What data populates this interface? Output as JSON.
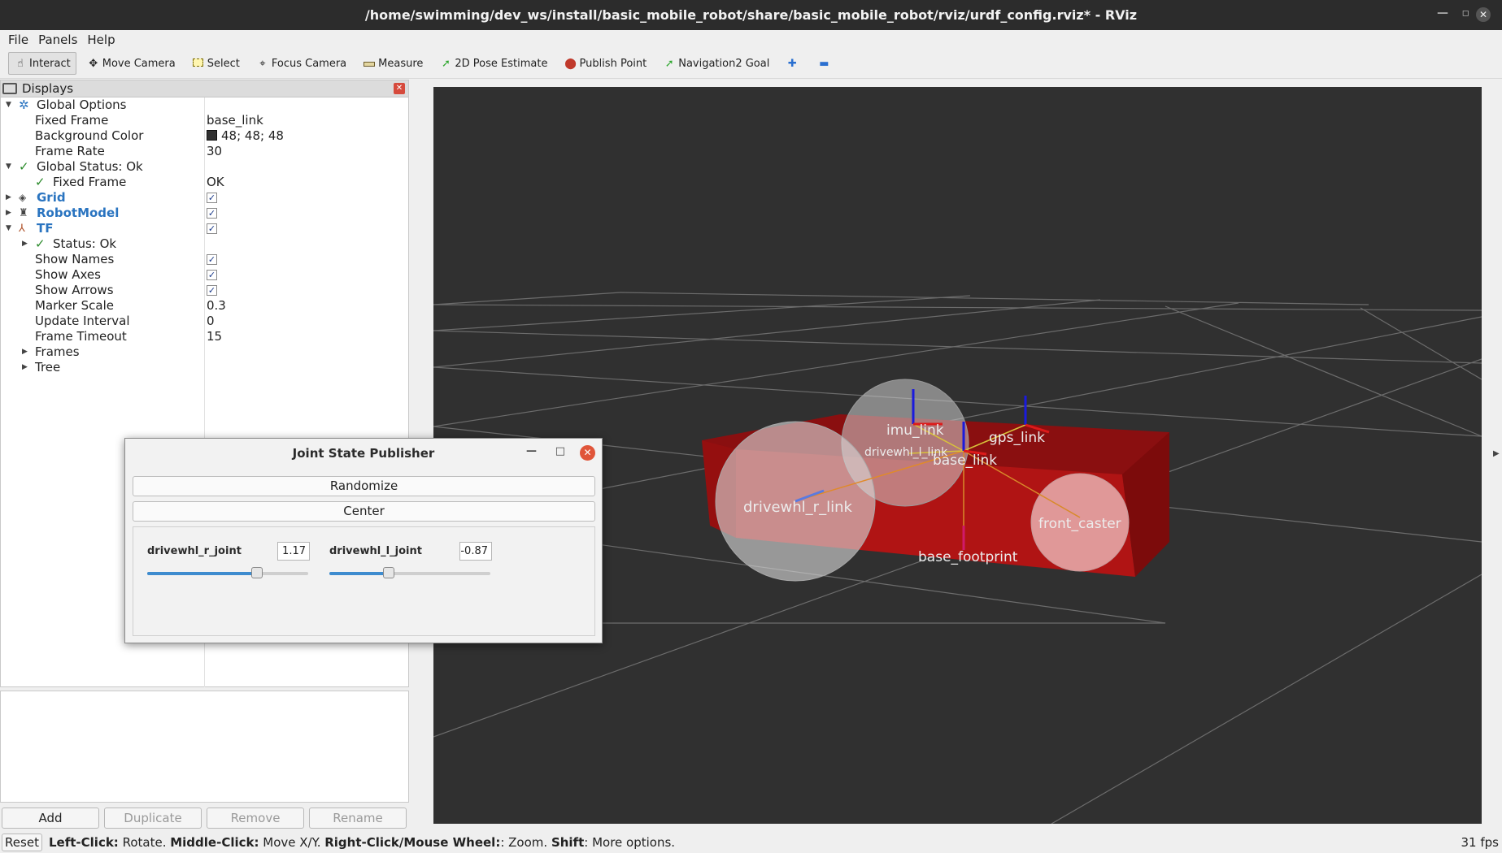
{
  "window": {
    "title": "/home/swimming/dev_ws/install/basic_mobile_robot/share/basic_mobile_robot/rviz/urdf_config.rviz* - RViz"
  },
  "menu": [
    "File",
    "Panels",
    "Help"
  ],
  "toolbar": [
    {
      "label": "Interact",
      "icon": "hand-icon",
      "active": true
    },
    {
      "label": "Move Camera",
      "icon": "move-camera-icon"
    },
    {
      "label": "Select",
      "icon": "select-icon"
    },
    {
      "label": "Focus Camera",
      "icon": "focus-camera-icon"
    },
    {
      "label": "Measure",
      "icon": "measure-icon"
    },
    {
      "label": "2D Pose Estimate",
      "icon": "pose-estimate-icon"
    },
    {
      "label": "Publish Point",
      "icon": "map-pin-icon"
    },
    {
      "label": "Navigation2 Goal",
      "icon": "nav-goal-icon"
    }
  ],
  "displays": {
    "title": "Displays",
    "global_options": {
      "label": "Global Options",
      "fixed_frame_label": "Fixed Frame",
      "fixed_frame": "base_link",
      "bg_label": "Background Color",
      "bg": "48; 48; 48",
      "bg_color": "#303030",
      "rate_label": "Frame Rate",
      "rate": "30"
    },
    "global_status": {
      "label": "Global Status: Ok",
      "fixed_frame_label": "Fixed Frame",
      "fixed_frame_value": "OK"
    },
    "grid": {
      "label": "Grid"
    },
    "robot_model": {
      "label": "RobotModel"
    },
    "tf": {
      "label": "TF",
      "status": "Status: Ok",
      "show_names_label": "Show Names",
      "show_axes_label": "Show Axes",
      "show_arrows_label": "Show Arrows",
      "marker_scale_label": "Marker Scale",
      "marker_scale": "0.3",
      "update_interval_label": "Update Interval",
      "update_interval": "0",
      "frame_timeout_label": "Frame Timeout",
      "frame_timeout": "15",
      "frames_label": "Frames",
      "tree_label": "Tree"
    },
    "buttons": {
      "add": "Add",
      "duplicate": "Duplicate",
      "remove": "Remove",
      "rename": "Rename"
    }
  },
  "jsp": {
    "title": "Joint State Publisher",
    "randomize": "Randomize",
    "center": "Center",
    "joints": [
      {
        "name": "drivewhl_r_joint",
        "value": "1.17",
        "fraction": 0.68
      },
      {
        "name": "drivewhl_l_joint",
        "value": "-0.87",
        "fraction": 0.37
      }
    ]
  },
  "viewport": {
    "labels": {
      "imu": "imu_link",
      "drivewhl_l": "drivewhl_l_link",
      "gps": "gps_link",
      "base": "base_link",
      "drivewhl_r": "drivewhl_r_link",
      "front_caster": "front_caster",
      "base_footprint": "base_footprint"
    }
  },
  "status": {
    "reset": "Reset",
    "hint_parts": [
      {
        "b": "Left-Click:",
        "t": " Rotate. "
      },
      {
        "b": "Middle-Click:",
        "t": " Move X/Y. "
      },
      {
        "b": "Right-Click/Mouse Wheel:",
        "t": ": Zoom. "
      },
      {
        "b": "Shift",
        "t": ": More options."
      }
    ],
    "fps": "31 fps"
  }
}
